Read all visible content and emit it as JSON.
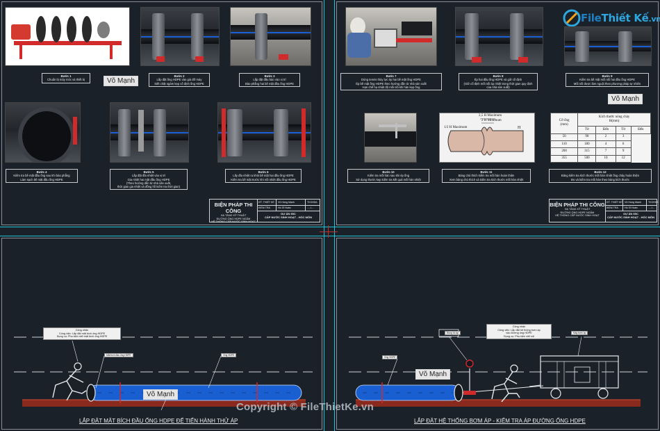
{
  "logo": {
    "text_main": "File",
    "text_rest": "Thiết Kế",
    "text_suffix": ".vn"
  },
  "watermark": "Copyright © FileThietKe.vn",
  "brand_label": "Võ Mạnh",
  "top_left": {
    "steps": [
      {
        "step": "Bước 1",
        "text": "Chuẩn bị máy móc và thiết bị"
      },
      {
        "step": "Bước 2",
        "text": "Lắp đặt ống HDPE vào giá đỡ máy\nSiết chặt ngàm kẹp cố định ống HDPE"
      },
      {
        "step": "Bước 3",
        "text": "Lắp đặt đầu bào vào vị trí\nBào phẳng hai bề mặt đầu ống HDPE"
      },
      {
        "step": "Bước 4",
        "text": "Kiểm tra bề mặt đầu ống sau khi bào phẳng\nLàm sạch bề mặt đầu ống HDPE"
      },
      {
        "step": "Bước 5",
        "text": "Lắp đặt đĩa nhiệt vào vị trí\nGia nhiệt hai mặt đầu ống HDPE\n(Theo hướng dẫn từ nhà sản xuất,\nthời gian gia nhiệt và đồng hồ kiểm tra thời gian)"
      },
      {
        "step": "Bước 6",
        "text": "Lấy đĩa nhiệt ra khỏi bề mặt hai đầu ống HDPE\nKiểm tra bề mặt trước khi nối nhiệt đầu ống HDPE"
      }
    ]
  },
  "top_right": {
    "steps": [
      {
        "step": "Bước 7",
        "text": "Dùng tennis thủy lực ép hai bề mặt ống HDPE\nÉp bề mặt ống HDPE theo hướng dẫn từ nhà sản xuất\nHạn chế hạ nhiệt độ mối nối khi hàn kẹp ống"
      },
      {
        "step": "Bước 8",
        "text": "Ép hai đầu ống HDPE và giữ cố định\n(Giữ cố định mối nối áp nhiệt trong thời gian quy định\ncủa nhà sản xuất)"
      },
      {
        "step": "Bước 9",
        "text": "Kiểm tra bề mặt mối nối hai đầu ống HDPE\nMối nối được làm nguội theo phương pháp tự nhiên"
      },
      {
        "step": "Bước 10",
        "text": "Kiểm tra mối hàn sau khi ép ống\nSử dụng thước kẹp kiểm tra kết quả mối hàn nhiệt"
      },
      {
        "step": "Bước 11",
        "text": "Bảng chú thích kiểm tra mối hàn hoàn thiện\nXem bảng chú thích và kiểm tra kích thước mối hàn nhiệt"
      },
      {
        "step": "Bước 12",
        "text": "Bảng kiểm tra kích thước mối hàn nhiệt ống chảy hoàn thiện\nĐo và kiểm tra mối hàn theo bảng kích thước"
      }
    ],
    "weld_labels": {
      "top": "2,5 H Maximum",
      "mid": "2 H Minimum",
      "left": "1/2 H Maximum",
      "right": "H"
    },
    "table": {
      "header_col1": "Cỡ ống\n(mm)",
      "header_group": "Kích thước nóng chảy\nH(mm)",
      "sub_headers": [
        "Từ",
        "Đến",
        "Từ",
        "Đến"
      ],
      "rows": [
        [
          "50",
          "90",
          "2",
          "3"
        ],
        [
          "110",
          "180",
          "4",
          "6"
        ],
        [
          "200",
          "315",
          "7",
          "9"
        ],
        [
          "355",
          "500",
          "10",
          "12"
        ]
      ]
    }
  },
  "title_block": {
    "main": "BIỆN PHÁP THI CÔNG",
    "sub1": "HẠ TẦNG KỸ THUẬT",
    "sub2": "ĐƯỜNG ỐNG HDPE NGẦM",
    "sub3": "HỆ THỐNG CẤP NƯỚC SINH HOẠT",
    "row1_label": "KỸ. THIẾT KẾ",
    "row1_value": "Võ Hùng Mạnh",
    "row1_code": "TKXHDA",
    "row2_label": "KIỂM TRA",
    "row2_value": "Hồ Sĩ Hoàn",
    "row2_code": "...../...",
    "project1": "DỰ ÁN 55C",
    "project2": "CẤP NƯỚC SINH HOẠT - HÓC MÔN"
  },
  "bottom_left": {
    "title": "LẮP ĐẶT MẶT BÍCH ĐẦU ỐNG HDPE ĐỂ TIẾN HÀNH THỬ ÁP",
    "worker_note": "Công nhân\nCông việc: Lắp đặt mặt bích ống HDPE\nDụng cụ: Phụ kiện xiết mặt bích ống HDPE",
    "tag1": "Mặt bích đầu ống HDPE",
    "tag2": "Ống HDPE"
  },
  "bottom_right": {
    "title": "LẮP ĐẶT HỆ THỐNG BƠM ÁP - KIỂM TRA ÁP ĐƯỜNG ỐNG HDPE",
    "worker_note": "Công nhân\nCông việc: Lắp đặt hệ thống bơm áp\nvào đường ống HDPE\nDụng cụ: Phụ kiện xiết nối",
    "tag1": "Ống HDPE",
    "tag2": "Máy bơm áp",
    "tag3": "Đồng hồ áp"
  },
  "colors": {
    "background": "#1b2128",
    "frame_cyan": "#1fc6d6",
    "pipe_blue": "#1a5fd1",
    "pipe_stripe": "#1b5fd6",
    "ground_red": "#8a2a1e",
    "accent_red": "#d12a2a"
  }
}
